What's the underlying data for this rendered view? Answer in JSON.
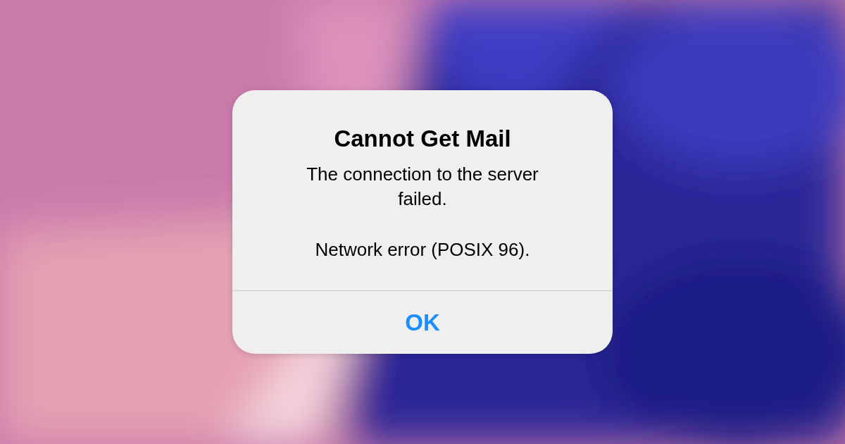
{
  "alert": {
    "title": "Cannot Get Mail",
    "message": [
      "The connection to the server failed.",
      "Network error (POSIX 96)."
    ],
    "buttons": [
      "OK"
    ]
  }
}
